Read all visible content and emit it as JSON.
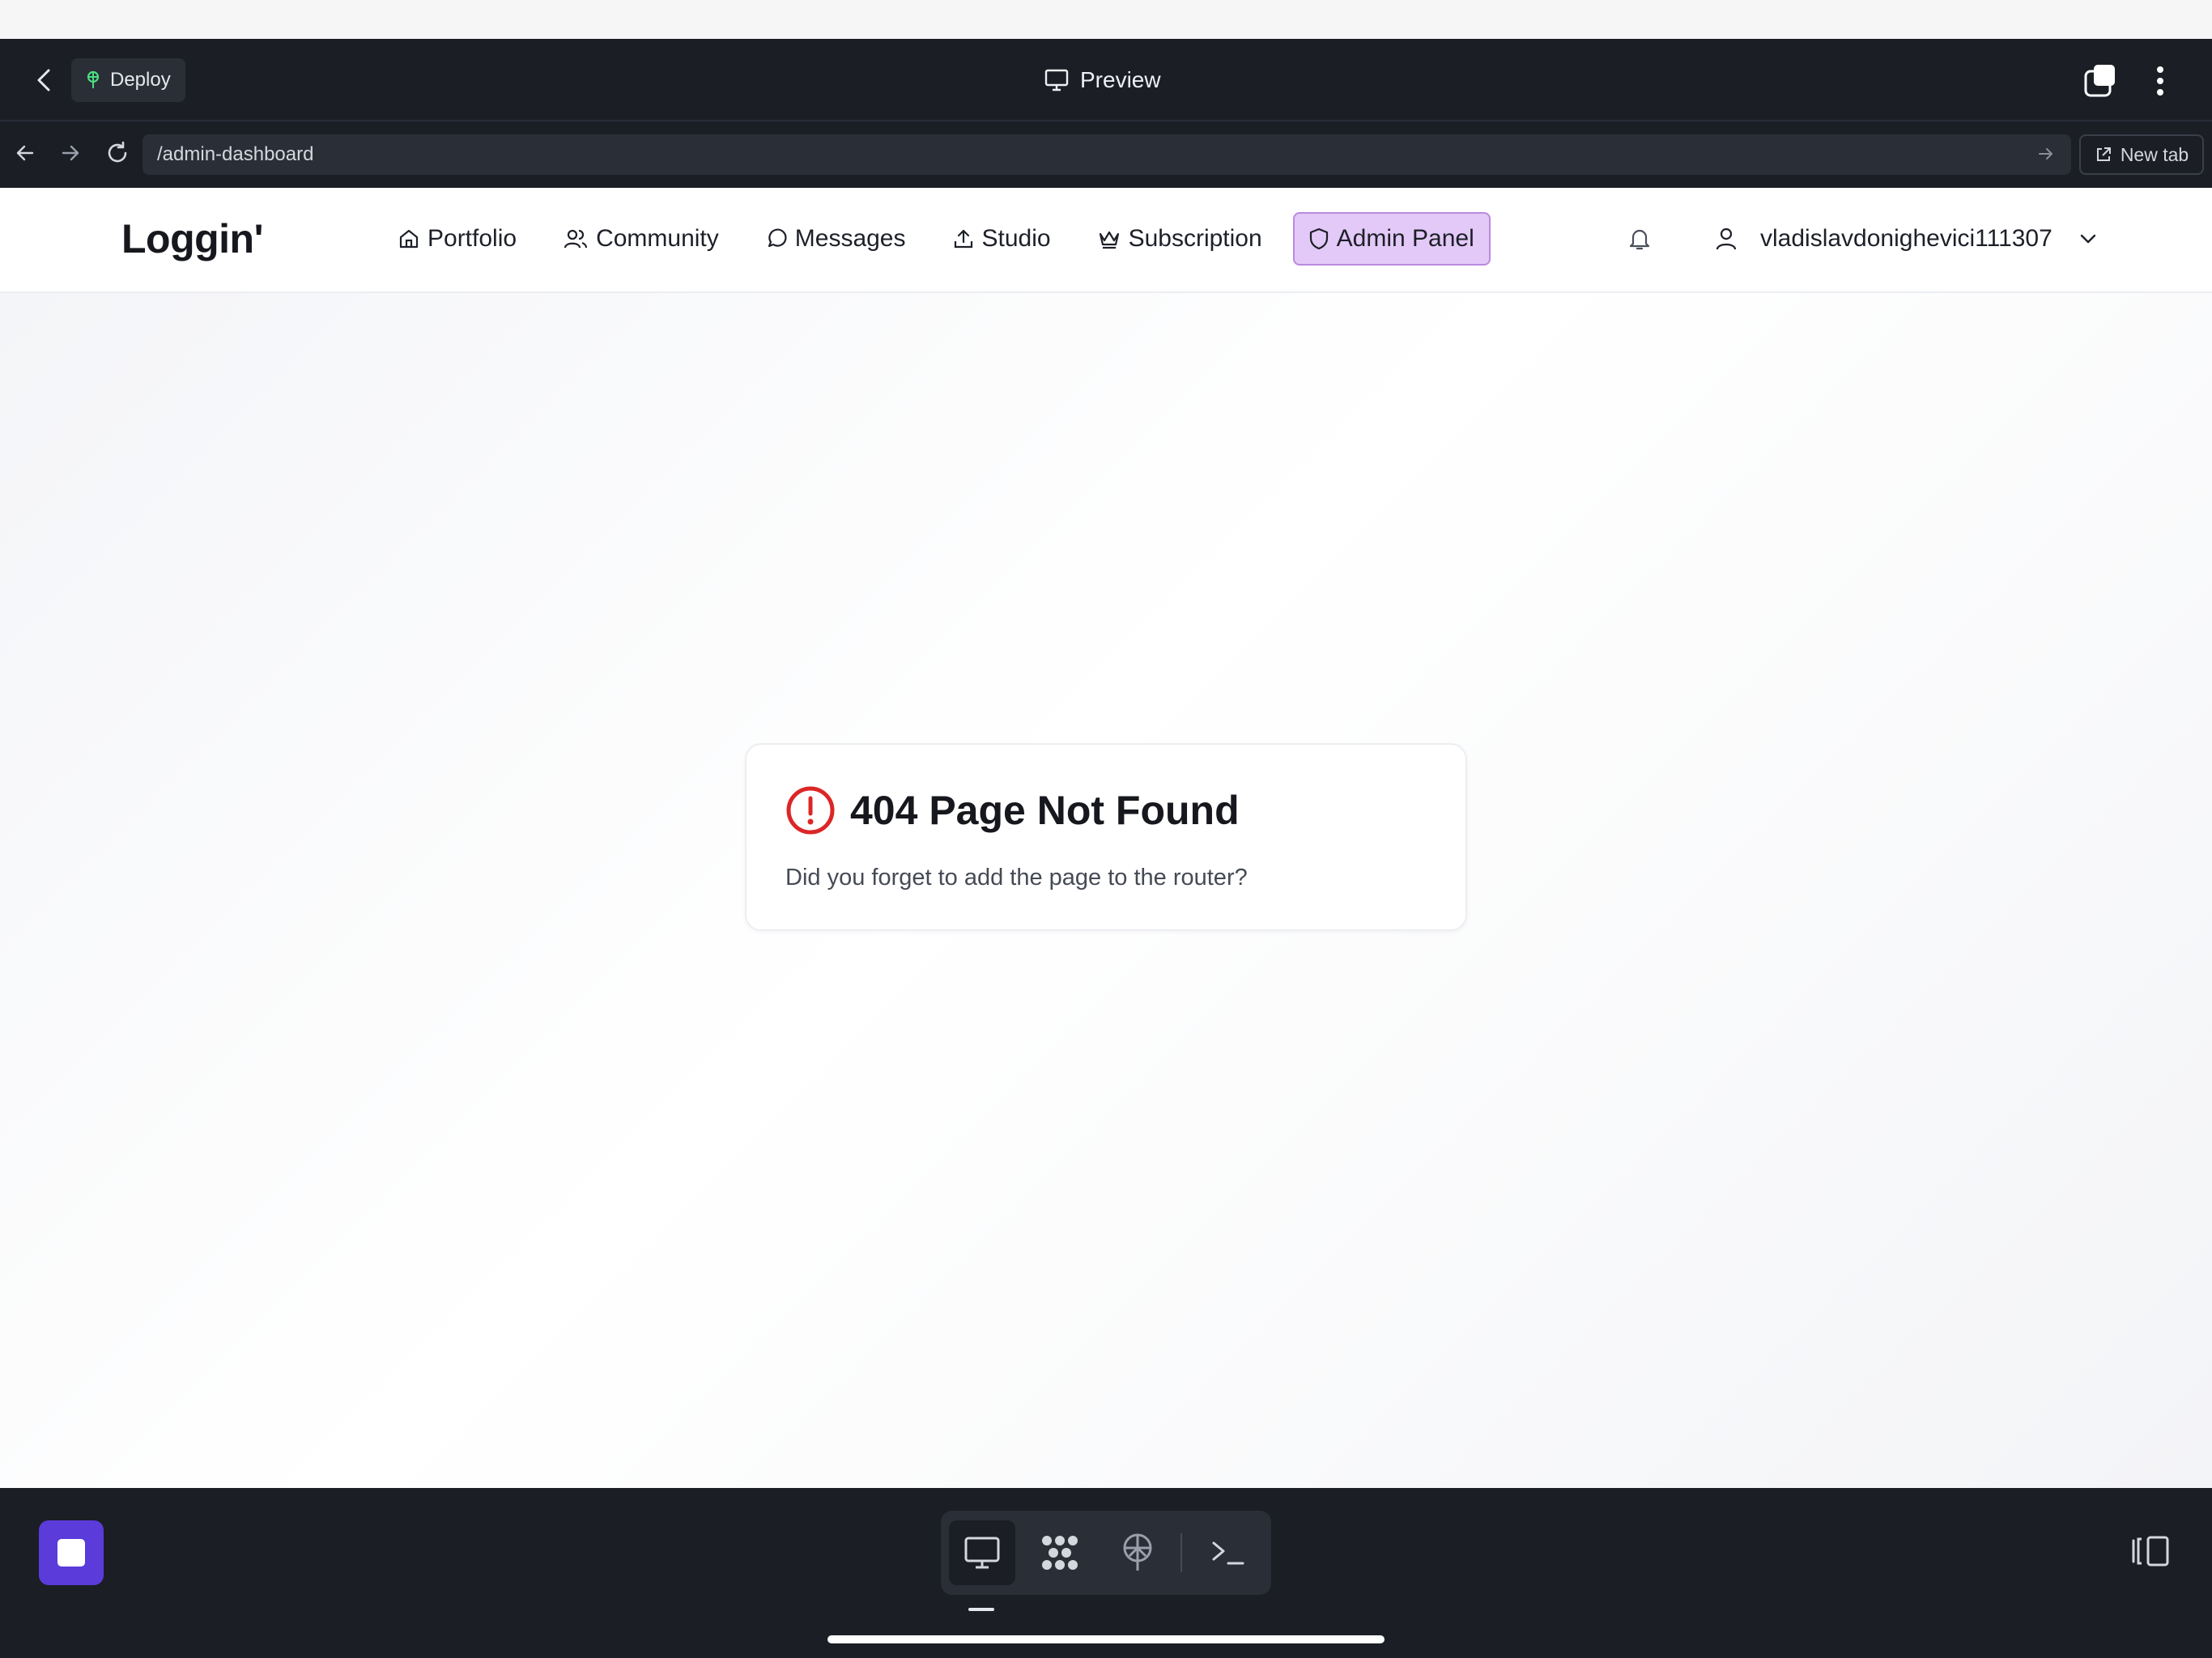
{
  "appbar": {
    "deploy_label": "Deploy",
    "preview_label": "Preview"
  },
  "urlbar": {
    "url": "/admin-dashboard",
    "new_tab_label": "New tab"
  },
  "site": {
    "logo": "Loggin'",
    "nav": [
      {
        "label": "Portfolio",
        "icon": "home-icon"
      },
      {
        "label": "Community",
        "icon": "users-icon"
      },
      {
        "label": "Messages",
        "icon": "message-circle-icon"
      },
      {
        "label": "Studio",
        "icon": "upload-icon"
      },
      {
        "label": "Subscription",
        "icon": "crown-icon"
      },
      {
        "label": "Admin Panel",
        "icon": "shield-icon",
        "active": true
      }
    ],
    "username": "vladislavdonighevici111307"
  },
  "error_card": {
    "title": "404 Page Not Found",
    "message": "Did you forget to add the page to the router?"
  },
  "colors": {
    "dark_bar": "#1b1e25",
    "accent_purple": "#5b3bd9",
    "active_nav_bg": "#e3c9f8",
    "error_red": "#dc2626",
    "deploy_green": "#4ade80"
  }
}
